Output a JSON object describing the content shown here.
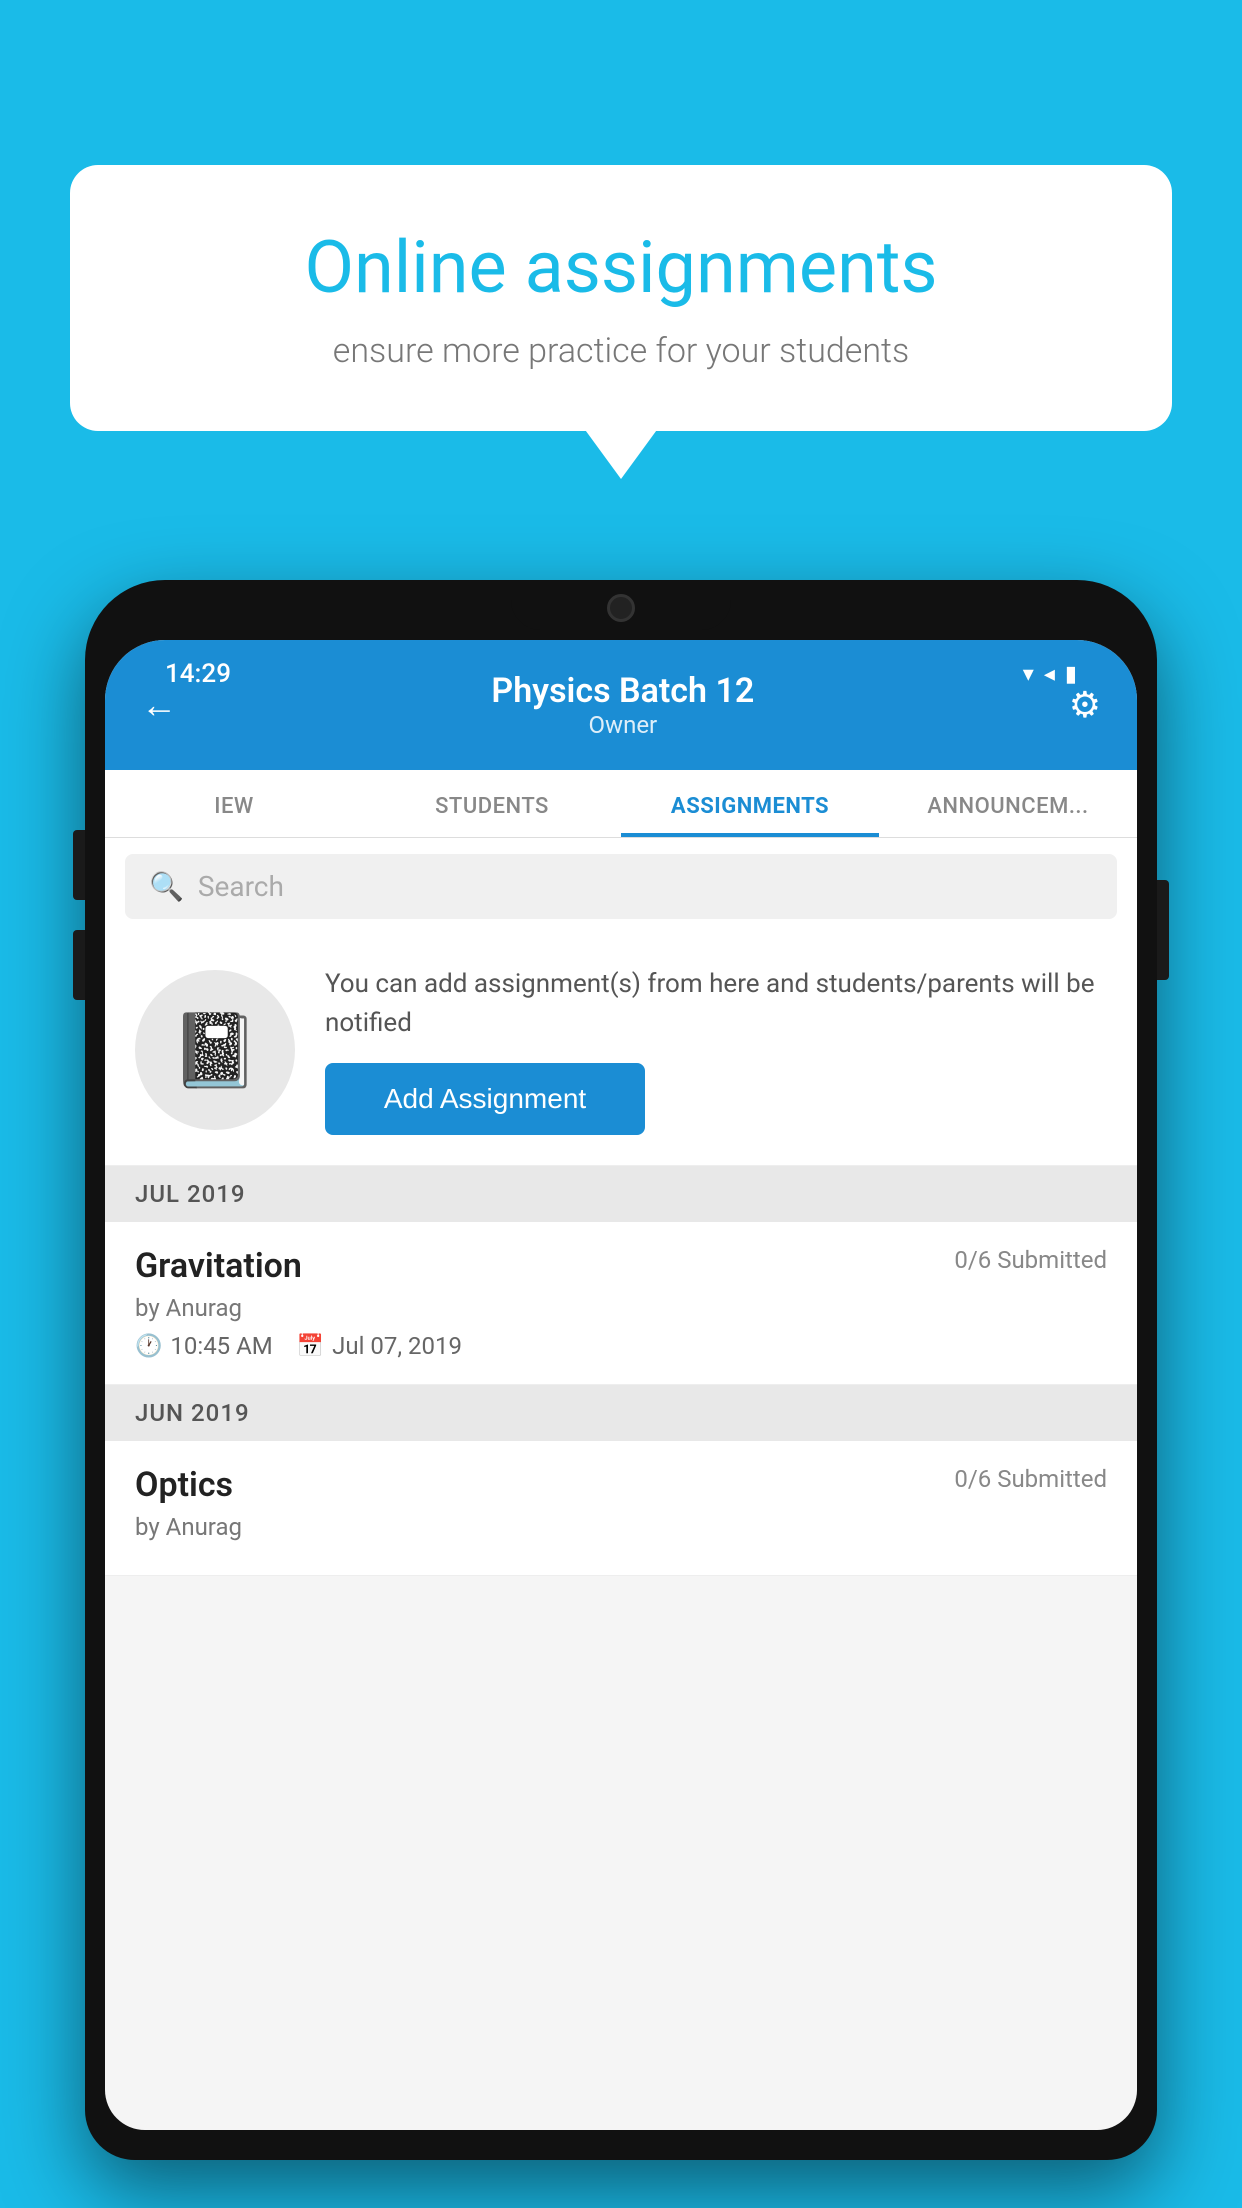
{
  "background": {
    "color": "#1ABBE8"
  },
  "speech_bubble": {
    "title": "Online assignments",
    "subtitle": "ensure more practice for your students"
  },
  "phone": {
    "status_bar": {
      "time": "14:29",
      "wifi_icon": "▼",
      "signal_icon": "▲",
      "battery_icon": "▮"
    },
    "header": {
      "title": "Physics Batch 12",
      "subtitle": "Owner",
      "back_label": "←",
      "gear_label": "⚙"
    },
    "tabs": [
      {
        "label": "IEW",
        "active": false
      },
      {
        "label": "STUDENTS",
        "active": false
      },
      {
        "label": "ASSIGNMENTS",
        "active": true
      },
      {
        "label": "ANNOUNCEM...",
        "active": false
      }
    ],
    "search": {
      "placeholder": "Search"
    },
    "add_assignment_section": {
      "description": "You can add assignment(s) from here and students/parents will be notified",
      "button_label": "Add Assignment"
    },
    "assignment_groups": [
      {
        "month_label": "JUL 2019",
        "assignments": [
          {
            "name": "Gravitation",
            "submitted": "0/6 Submitted",
            "author": "by Anurag",
            "time": "10:45 AM",
            "date": "Jul 07, 2019"
          }
        ]
      },
      {
        "month_label": "JUN 2019",
        "assignments": [
          {
            "name": "Optics",
            "submitted": "0/6 Submitted",
            "author": "by Anurag",
            "time": "",
            "date": ""
          }
        ]
      }
    ]
  }
}
